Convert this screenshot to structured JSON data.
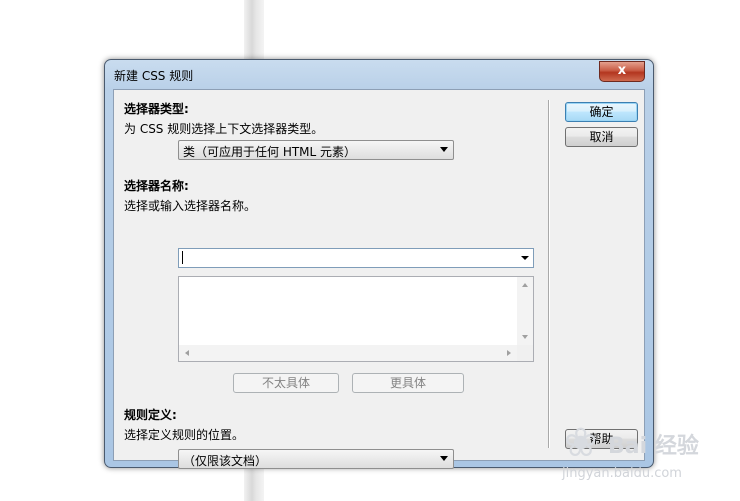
{
  "window": {
    "title": "新建 CSS 规则",
    "close_glyph": "x"
  },
  "selector_type": {
    "label": "选择器类型:",
    "desc": "为 CSS 规则选择上下文选择器类型。",
    "value": "类（可应用于任何 HTML 元素）"
  },
  "selector_name": {
    "label": "选择器名称:",
    "desc": "选择或输入选择器名称。",
    "value": ""
  },
  "specificity": {
    "less_label": "不太具体",
    "more_label": "更具体"
  },
  "rule_definition": {
    "label": "规则定义:",
    "desc": "选择定义规则的位置。",
    "value": "（仅限该文档）"
  },
  "buttons": {
    "ok": "确定",
    "cancel": "取消",
    "help": "帮助"
  },
  "watermark": {
    "text": "Bai 经验",
    "url": "jingyan.baidu.com"
  }
}
